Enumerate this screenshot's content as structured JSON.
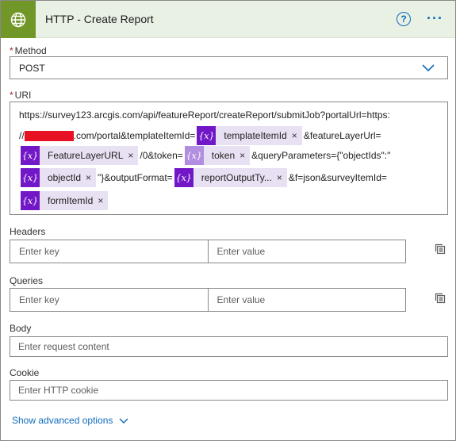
{
  "header": {
    "title": "HTTP - Create Report",
    "icon": "globe-icon",
    "help_icon": "help-circle-icon",
    "help_glyph": "?",
    "more_icon": "more-options-icon",
    "more_glyph": "···",
    "accent_color": "#709727"
  },
  "method": {
    "label": "Method",
    "required_mark": "*",
    "value": "POST"
  },
  "uri": {
    "label": "URI",
    "required_mark": "*",
    "line1": "https://survey123.arcgis.com/api/featureReport/createReport/submitJob?portalUrl=https:",
    "line2_prefix": "//",
    "line2_mid": ".com/portal&templateItemId=",
    "line2_suffix": "&featureLayerUrl=",
    "line3_mid": "/0&token=",
    "line3_suffix": "&queryParameters={\"objectIds\":\"",
    "line4_mid": "\"}&outputFormat=",
    "line4_suffix": "&f=json&surveyItemId=",
    "tokens": [
      {
        "fx": "{x}",
        "name": "templateItemId",
        "remove": "×"
      },
      {
        "fx": "{x}",
        "name": "FeatureLayerURL",
        "remove": "×"
      },
      {
        "fx": "{x}",
        "name": "token",
        "remove": "×"
      },
      {
        "fx": "{x}",
        "name": "objectId",
        "remove": "×"
      },
      {
        "fx": "{x}",
        "name": "reportOutputTy...",
        "remove": "×"
      },
      {
        "fx": "{x}",
        "name": "formItemId",
        "remove": "×"
      }
    ]
  },
  "headers": {
    "label": "Headers",
    "key_placeholder": "Enter key",
    "value_placeholder": "Enter value"
  },
  "queries": {
    "label": "Queries",
    "key_placeholder": "Enter key",
    "value_placeholder": "Enter value"
  },
  "body": {
    "label": "Body",
    "placeholder": "Enter request content"
  },
  "cookie": {
    "label": "Cookie",
    "placeholder": "Enter HTTP cookie"
  },
  "advanced": {
    "label": "Show advanced options"
  }
}
